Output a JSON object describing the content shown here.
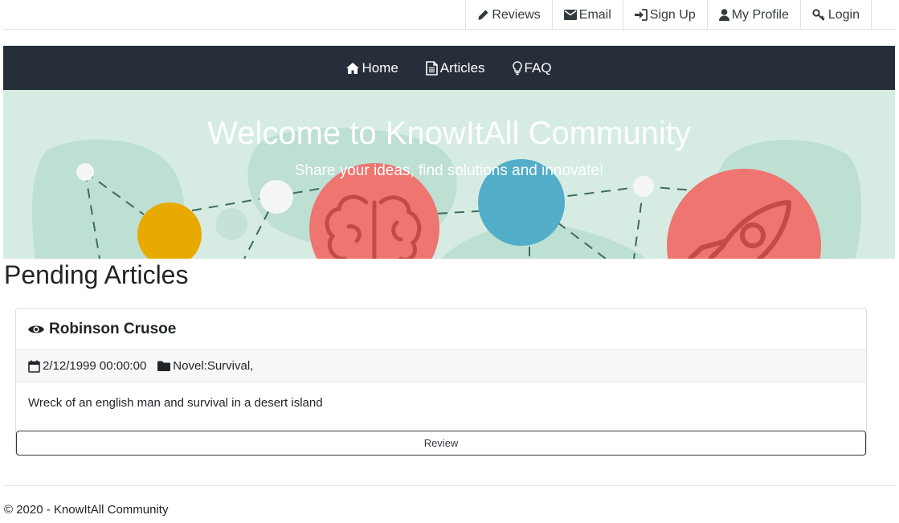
{
  "top_nav": {
    "reviews": "Reviews",
    "email": "Email",
    "sign_up": "Sign Up",
    "my_profile": "My Profile",
    "login": "Login"
  },
  "main_nav": {
    "home": "Home",
    "articles": "Articles",
    "faq": "FAQ"
  },
  "hero": {
    "title": "Welcome to KnowItAll Community",
    "subtitle": "Share your ideas, find solutions and innovate!"
  },
  "page_heading": "Pending Articles",
  "articles": [
    {
      "title": "Robinson Crusoe",
      "date": "2/12/1999 00:00:00",
      "category": "Novel:Survival,",
      "description": "Wreck of an english man and survival in a desert island",
      "action": "Review"
    }
  ],
  "footer": "© 2020 - KnowItAll Community",
  "colors": {
    "navbar": "#262e3a",
    "hero_bg": "#d6ece2",
    "hero_blob": "#bde0d2",
    "yellow": "#e8a900",
    "red": "#ee7570",
    "blue": "#52adc8"
  }
}
